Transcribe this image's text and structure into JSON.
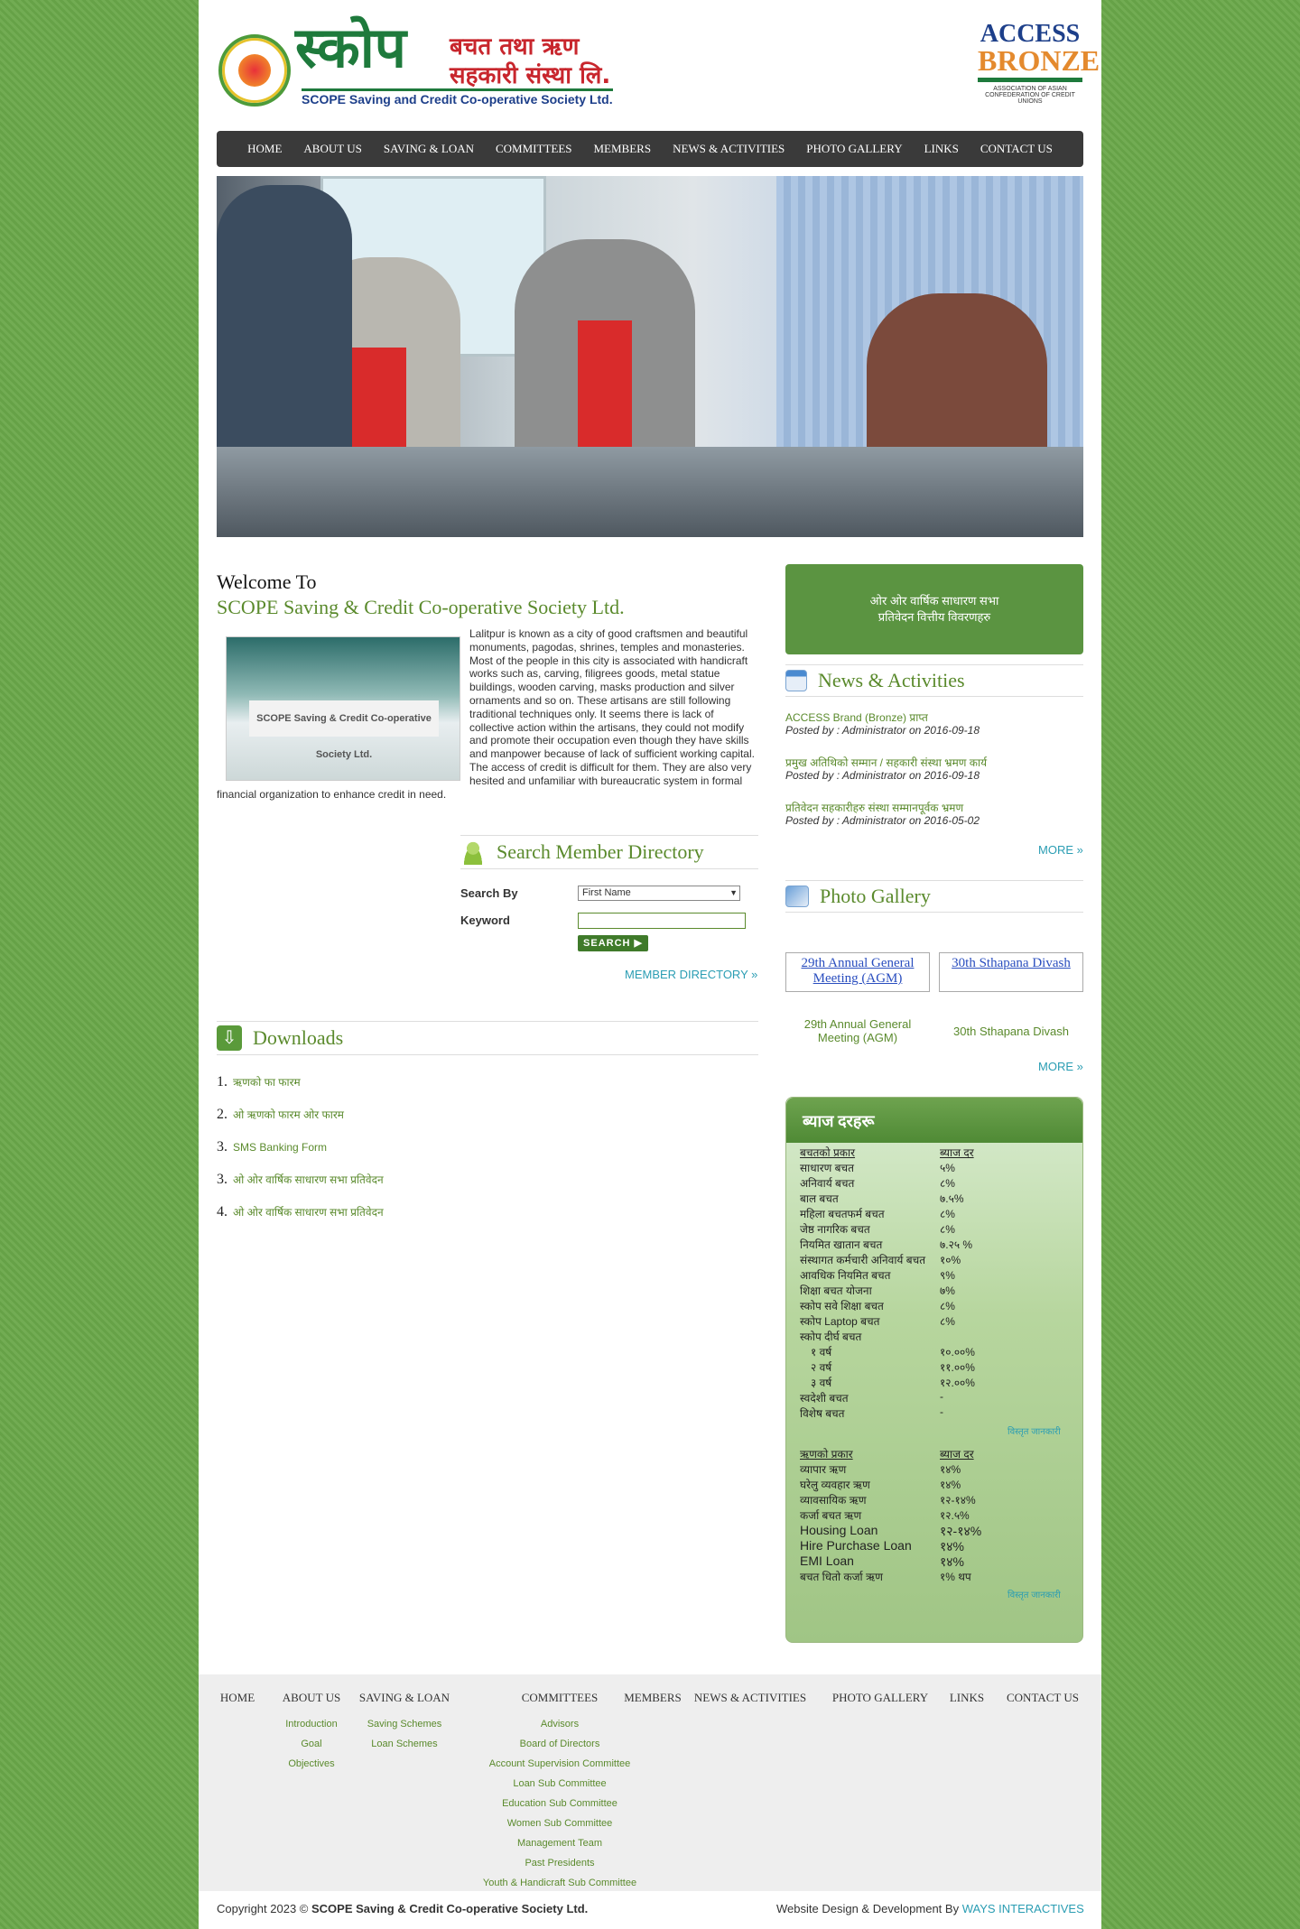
{
  "header": {
    "logo_devanagari": "स्कोप",
    "logo_sub1": "बचत तथा ऋण",
    "logo_sub2": "सहकारी संस्था लि.",
    "logo_english": "SCOPE Saving and Credit Co-operative Society Ltd.",
    "badge_line1": "ACCESS",
    "badge_line2": "BRONZE",
    "badge_line3": "ASSOCIATION OF ASIAN CONFEDERATION OF CREDIT UNIONS"
  },
  "nav": [
    "HOME",
    "ABOUT US",
    "SAVING & LOAN",
    "COMMITTEES",
    "MEMBERS",
    "NEWS & ACTIVITIES",
    "PHOTO GALLERY",
    "LINKS",
    "CONTACT US"
  ],
  "welcome": {
    "heading": "Welcome To",
    "name": "SCOPE Saving & Credit Co-operative Society Ltd.",
    "sign_text": "SCOPE Saving & Credit Co-operative Society Ltd.",
    "body": "Lalitpur is known as a city of good craftsmen and beautiful monuments, pagodas, shrines, temples and monasteries. Most of the people in this city is associated with handicraft works such as, carving, filigrees goods, metal statue buildings, wooden carving, masks production and silver ornaments and so on. These artisans are still following traditional techniques only. It seems there is lack of collective action within the artisans, they could not modify and promote their occupation even though they have skills and manpower because of lack of sufficient working capital. The access of credit is difficult for them. They are also very hesited and unfamiliar with bureaucratic system in formal financial organization to enhance credit in need."
  },
  "search": {
    "title": "Search Member Directory",
    "search_by_label": "Search By",
    "search_by_value": "First Name",
    "keyword_label": "Keyword",
    "button": "SEARCH ▶",
    "directory_link": "MEMBER DIRECTORY »"
  },
  "downloads": {
    "title": "Downloads",
    "items": [
      {
        "num": "1.",
        "label": "ऋणको फा फारम"
      },
      {
        "num": "2.",
        "label": "ओ ऋणको फारम ओर फारम"
      },
      {
        "num": "3.",
        "label": "SMS Banking Form"
      },
      {
        "num": "3.",
        "label": "ओ ओर वार्षिक साधारण सभा प्रतिवेदन"
      },
      {
        "num": "4.",
        "label": "ओ ओर वार्षिक साधारण सभा प्रतिवेदन"
      }
    ]
  },
  "notice": {
    "line1": "ओर ओर वार्षिक साधारण सभा",
    "line2": "प्रतिवेदन वित्तीय विवरणहरु"
  },
  "news": {
    "title": "News & Activities",
    "items": [
      {
        "title": "ACCESS Brand (Bronze) प्राप्त",
        "posted": "Posted by : Administrator on 2016-09-18"
      },
      {
        "title": "प्रमुख अतिथिको सम्मान / सहकारी संस्था भ्रमण कार्य",
        "posted": "Posted by : Administrator on 2016-09-18"
      },
      {
        "title": "प्रतिवेदन सहकारीहरु संस्था सम्मानपूर्वक भ्रमण",
        "posted": "Posted by : Administrator on 2016-05-02"
      }
    ],
    "more": "MORE »"
  },
  "gallery": {
    "title": "Photo Gallery",
    "items": [
      {
        "alt": "29th Annual General Meeting (AGM)",
        "caption": "29th Annual General Meeting (AGM)"
      },
      {
        "alt": "30th Sthapana Divash",
        "caption": "30th Sthapana Divash"
      }
    ],
    "more": "MORE »"
  },
  "rates": {
    "title": "ब्याज दरहरू",
    "savings_header": {
      "k": "बचतको प्रकार",
      "v": "ब्याज दर"
    },
    "savings": [
      {
        "k": "साधारण बचत",
        "v": "५%"
      },
      {
        "k": "अनिवार्य बचत",
        "v": "८%"
      },
      {
        "k": "बाल बचत",
        "v": "७.५%"
      },
      {
        "k": "महिला बचतफर्म बचत",
        "v": "८%"
      },
      {
        "k": "जेष्ठ नागरिक बचत",
        "v": "८%"
      },
      {
        "k": "नियमित खातान बचत",
        "v": "७.२५ %"
      },
      {
        "k": "संस्थागत कर्मचारी अनिवार्य बचत",
        "v": "१०%"
      },
      {
        "k": "आवधिक नियमित बचत",
        "v": "९%"
      },
      {
        "k": "शिक्षा बचत योजना",
        "v": "७%"
      },
      {
        "k": "स्कोप सवे शिक्षा बचत",
        "v": "८%"
      },
      {
        "k": "स्कोप Laptop बचत",
        "v": "८%"
      },
      {
        "k": "स्कोप दीर्घ बचत",
        "v": ""
      },
      {
        "k": "१ वर्ष",
        "v": "१०.००%",
        "indent": true
      },
      {
        "k": "२ वर्ष",
        "v": "११.००%",
        "indent": true
      },
      {
        "k": "३ वर्ष",
        "v": "१२.००%",
        "indent": true
      },
      {
        "k": "स्वदेशी बचत",
        "v": "-"
      },
      {
        "k": "विशेष बचत",
        "v": "-"
      }
    ],
    "savings_detail": "विस्तृत जानकारी",
    "loan_header": {
      "k": "ऋणको प्रकार",
      "v": "ब्याज दर"
    },
    "loans": [
      {
        "k": "व्यापार ऋण",
        "v": "१४%"
      },
      {
        "k": "घरेलु व्यवहार ऋण",
        "v": "१४%"
      },
      {
        "k": "व्यावसायिक ऋण",
        "v": "१२-१४%"
      },
      {
        "k": "कर्जा बचत ऋण",
        "v": "१२.५%"
      },
      {
        "k": "Housing Loan",
        "v": "१२-१४%",
        "big": true
      },
      {
        "k": "Hire Purchase Loan",
        "v": "१४%",
        "big": true
      },
      {
        "k": "EMI Loan",
        "v": "१४%",
        "big": true
      },
      {
        "k": "बचत धितो कर्जा ऋण",
        "v": "१% थप"
      }
    ],
    "loan_detail": "विस्तृत जानकारी"
  },
  "footer": {
    "cols": [
      {
        "title": "HOME",
        "items": []
      },
      {
        "title": "ABOUT US",
        "items": [
          "Introduction",
          "Goal",
          "Objectives"
        ]
      },
      {
        "title": "SAVING & LOAN",
        "items": [
          "Saving Schemes",
          "Loan Schemes"
        ]
      },
      {
        "title": "COMMITTEES",
        "items": [
          "Advisors",
          "Board of Directors",
          "Account Supervision Committee",
          "Loan Sub Committee",
          "Education Sub Committee",
          "Women Sub Committee",
          "Management Team",
          "Past Presidents",
          "Youth & Handicraft Sub Committee"
        ]
      },
      {
        "title": "MEMBERS",
        "items": []
      },
      {
        "title": "NEWS & ACTIVITIES",
        "items": []
      },
      {
        "title": "PHOTO GALLERY",
        "items": []
      },
      {
        "title": "LINKS",
        "items": []
      },
      {
        "title": "CONTACT US",
        "items": []
      }
    ],
    "copyright_prefix": "Copyright 2023 © ",
    "copyright_name": "SCOPE Saving & Credit Co-operative Society Ltd.",
    "credit_prefix": "Website Design & Development By ",
    "credit_link": "WAYS INTERACTIVES"
  },
  "colors": {
    "brand_green": "#5a8a2c",
    "nav_bg": "#3a3a3a",
    "link_blue": "#2a9db3"
  }
}
